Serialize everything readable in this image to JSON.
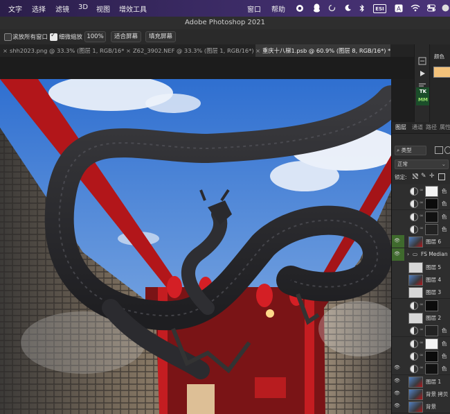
{
  "menubar": {
    "items": [
      "文字",
      "选择",
      "滤镜",
      "3D",
      "视图",
      "增效工具"
    ],
    "right_items": [
      "窗口",
      "帮助"
    ],
    "status_badge": "ESI"
  },
  "window": {
    "title": "Adobe Photoshop 2021"
  },
  "options_bar": {
    "scroll_all_label": "滚放所有窗口",
    "fine_zoom_label": "细微缩放",
    "zoom_value": "100%",
    "fit_screen_label": "适合屏幕",
    "fill_screen_label": "填充屏幕"
  },
  "tabs": [
    {
      "label": "shh2023.png @ 33.3% (图层 1, RGB/16*)"
    },
    {
      "label": "Z62_3902.NEF @ 33.3% (图层 1, RGB/16*) *"
    },
    {
      "label": "重庆十八梯1.psb @ 60.9% (图层 8, RGB/16*) *"
    }
  ],
  "right_panel": {
    "color_tab": "颜色",
    "tk_label": "TK",
    "mm_label": "MM"
  },
  "layers_panel": {
    "tabs": [
      "图层",
      "通道",
      "路径",
      "属性"
    ],
    "filter_label": "类型",
    "blend_mode": "正常",
    "lock_label": "锁定:",
    "layers": [
      {
        "name": "色",
        "kind": "adjust",
        "visible": false
      },
      {
        "name": "色",
        "kind": "adjust",
        "visible": false
      },
      {
        "name": "色",
        "kind": "adjust",
        "visible": false
      },
      {
        "name": "色",
        "kind": "adjust",
        "visible": false
      },
      {
        "name": "图层 6",
        "kind": "pixel",
        "visible": true
      },
      {
        "name": "FS Median",
        "kind": "group",
        "visible": true
      },
      {
        "name": "图层 5",
        "kind": "pixel",
        "visible": false
      },
      {
        "name": "图层 4",
        "kind": "pixel",
        "visible": false
      },
      {
        "name": "图层 3",
        "kind": "pixel",
        "visible": false
      },
      {
        "name": "",
        "kind": "adjust",
        "visible": false
      },
      {
        "name": "图层 2",
        "kind": "pixel",
        "visible": false
      },
      {
        "name": "色",
        "kind": "adjust",
        "visible": false
      },
      {
        "name": "色",
        "kind": "adjust",
        "visible": false
      },
      {
        "name": "色",
        "kind": "adjust",
        "visible": false
      },
      {
        "name": "色",
        "kind": "adjust",
        "visible": true
      },
      {
        "name": "图层 1",
        "kind": "pixel",
        "visible": true
      },
      {
        "name": "背景 拷贝",
        "kind": "pixel",
        "visible": true
      },
      {
        "name": "背景",
        "kind": "pixel",
        "visible": true
      }
    ]
  },
  "colors": {
    "accent_green": "#3f6a2d",
    "swatch": "#f3c27a"
  }
}
